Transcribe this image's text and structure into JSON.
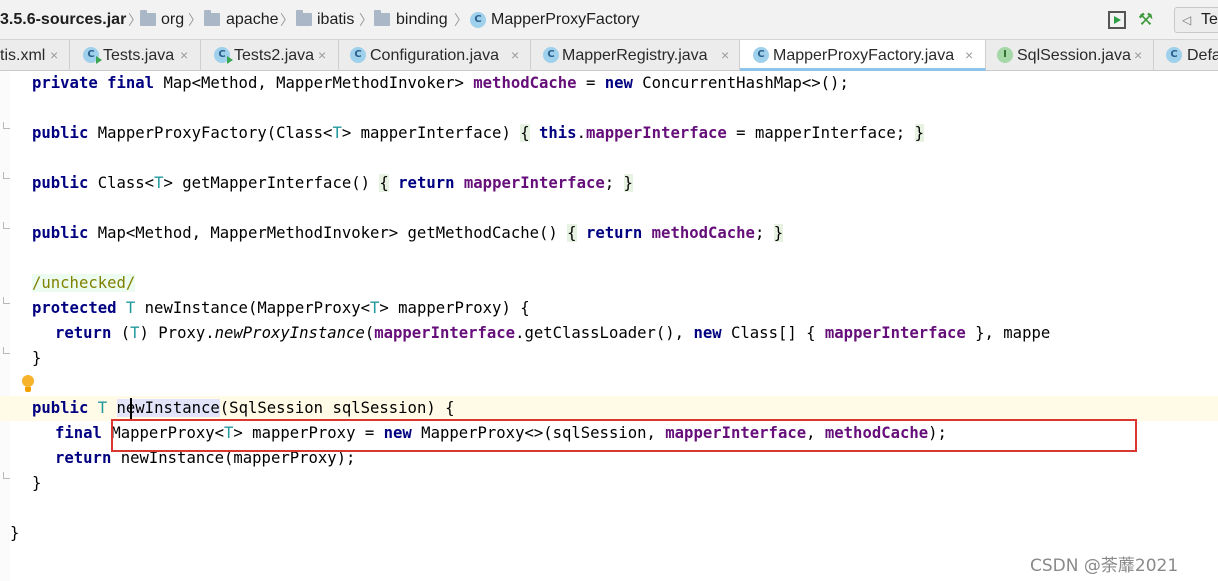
{
  "breadcrumb": {
    "jar": "3.5.6-sources.jar",
    "folders": [
      "org",
      "apache",
      "ibatis",
      "binding"
    ],
    "current_class": "MapperProxyFactory",
    "class_icon_letter": "C",
    "right_tab_fragment": "Te"
  },
  "tabs": [
    {
      "label": "tis.xml",
      "icon": "none",
      "active": false
    },
    {
      "label": "Tests.java",
      "icon": "run-class",
      "active": false
    },
    {
      "label": "Tests2.java",
      "icon": "run-class",
      "active": false
    },
    {
      "label": "Configuration.java",
      "icon": "class",
      "active": false
    },
    {
      "label": "MapperRegistry.java",
      "icon": "class",
      "active": false
    },
    {
      "label": "MapperProxyFactory.java",
      "icon": "class",
      "active": true
    },
    {
      "label": "SqlSession.java",
      "icon": "interface",
      "active": false
    },
    {
      "label": "Defa",
      "icon": "class",
      "active": false
    }
  ],
  "tab_close_glyph": "×",
  "icon_letters": {
    "class": "C",
    "interface": "I"
  },
  "code": {
    "l1": {
      "kw1": "private",
      "kw2": "final",
      "type": "Map<Method, MapperMethodInvoker>",
      "field": "methodCache",
      "eq": " = ",
      "kw3": "new",
      "rest": " ConcurrentHashMap<>();"
    },
    "l2": {
      "kw1": "public",
      "sig": " MapperProxyFactory(Class<",
      "t": "T",
      "sig2": "> mapperInterface) ",
      "ob": "{",
      "kw2": "this",
      "dot": ".",
      "field": "mapperInterface",
      "rest": " = mapperInterface; ",
      "cb": "}"
    },
    "l3": {
      "kw1": "public",
      "sig": " Class<",
      "t": "T",
      "sig2": "> getMapperInterface() ",
      "ob": "{",
      "kw2": "return",
      "field": "mapperInterface",
      "semi": "; ",
      "cb": "}"
    },
    "l4": {
      "kw1": "public",
      "sig": " Map<Method, MapperMethodInvoker> getMethodCache() ",
      "ob": "{",
      "kw2": "return",
      "field": "methodCache",
      "semi": "; ",
      "cb": "}"
    },
    "l5": {
      "annotation": "/unchecked/"
    },
    "l6": {
      "kw1": "protected",
      "t": "T",
      "sig": " newInstance(MapperProxy<",
      "t2": "T",
      "sig2": "> mapperProxy) {"
    },
    "l7": {
      "kw1": "return",
      "cast_open": " (",
      "t": "T",
      "cast_close": ") Proxy.",
      "method": "newProxyInstance",
      "p1": "(",
      "field1": "mapperInterface",
      "p2": ".getClassLoader(), ",
      "kw2": "new",
      "p3": " Class[] { ",
      "field2": "mapperInterface",
      "p4": " }, mappe"
    },
    "l8": {
      "brace": "}"
    },
    "l9": {
      "kw1": "public",
      "t": "T",
      "name": "newInstance",
      "rest": "(SqlSession sqlSession) {"
    },
    "l10": {
      "kw1": "final",
      "p1": " MapperProxy<",
      "t": "T",
      "p2": "> mapperProxy = ",
      "kw2": "new",
      "p3": " MapperProxy<>(sqlSession, ",
      "field1": "mapperInterface",
      "p4": ", ",
      "field2": "methodCache",
      "p5": ");"
    },
    "l11": {
      "kw1": "return",
      "rest": " newInstance(mapperProxy);"
    },
    "l12": {
      "brace": "}"
    },
    "l13": {
      "brace": "}"
    }
  },
  "watermark": "CSDN @荼蘼2021",
  "colors": {
    "keyword": "#000080",
    "field": "#660e7a",
    "type_param": "#20999d",
    "annotation": "#808000",
    "highlight_box": "#d9372f"
  }
}
